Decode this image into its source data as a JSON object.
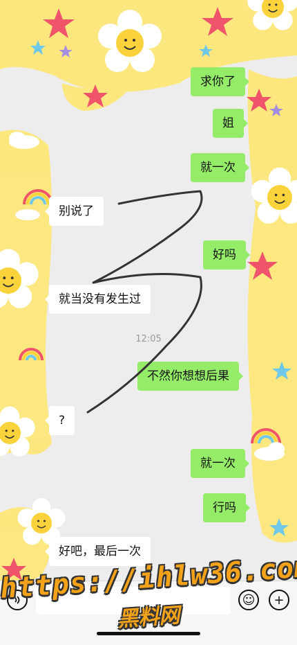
{
  "messages": [
    {
      "from": "me",
      "text": "求你了"
    },
    {
      "from": "me",
      "text": "姐"
    },
    {
      "from": "me",
      "text": "就一次"
    },
    {
      "from": "them",
      "text": "别说了"
    },
    {
      "from": "me",
      "text": "好吗"
    },
    {
      "from": "them",
      "text": "就当没有发生过"
    },
    {
      "from": "me",
      "text": "不然你想想后果"
    },
    {
      "from": "them",
      "text": "?"
    },
    {
      "from": "me",
      "text": "就一次"
    },
    {
      "from": "me",
      "text": "行吗"
    },
    {
      "from": "them",
      "text": "好吧，最后一次"
    }
  ],
  "timestamp": "12:05",
  "input_bar": {
    "voice_icon": "voice-icon",
    "emoji_icon": "emoji-icon",
    "add_icon": "plus-icon",
    "emoji_glyph": "☺",
    "add_glyph": "+"
  },
  "watermark": {
    "line1": "https://ihlw36.com",
    "line2": "黑料网"
  },
  "colors": {
    "my_bubble": "#95ec69",
    "their_bubble": "#ffffff",
    "background": "#ededed",
    "sticker_yellow": "#fde77a",
    "watermark": "#f3a21a"
  }
}
